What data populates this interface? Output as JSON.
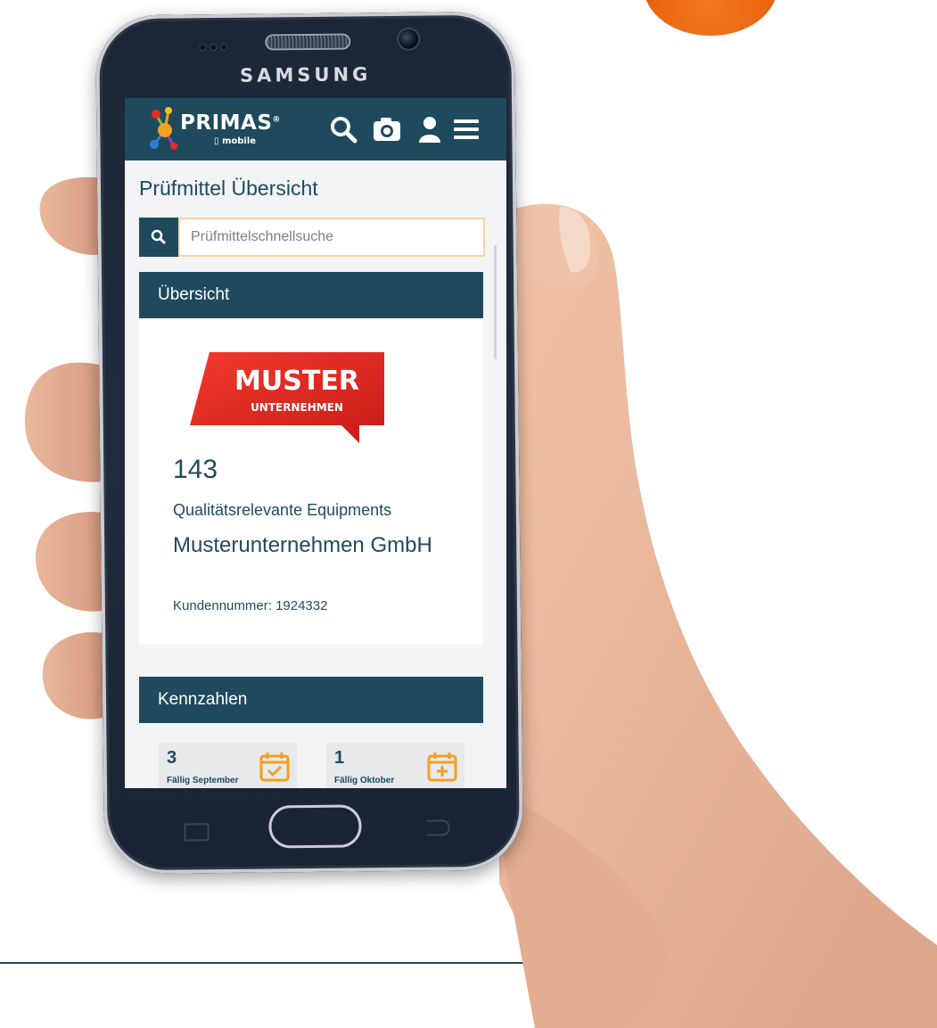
{
  "device": {
    "brand": "SAMSUNG"
  },
  "app": {
    "logo_text": "PRIMAS",
    "logo_registered": "®",
    "logo_sub": "mobile",
    "nav_icons": [
      "search-icon",
      "camera-icon",
      "user-icon",
      "menu-icon"
    ]
  },
  "page": {
    "title": "Prüfmittel Übersicht"
  },
  "search": {
    "placeholder": "Prüfmittelschnellsuche"
  },
  "overview": {
    "header": "Übersicht",
    "logo_line1": "MUSTER",
    "logo_line2": "UNTERNEHMEN",
    "count": "143",
    "count_label": "Qualitätsrelevante Equipments",
    "company": "Musterunternehmen GmbH",
    "customer_number": "Kundennummer: 1924332"
  },
  "kpis": {
    "header": "Kennzahlen",
    "items": [
      {
        "value": "3",
        "label": "Fällig September",
        "icon": "calendar-check-icon"
      },
      {
        "value": "1",
        "label": "Fällig Oktober",
        "icon": "calendar-plus-icon"
      }
    ]
  },
  "colors": {
    "primary": "#1f4a5e",
    "accent": "#f4a020",
    "brand_red": "#e52b24",
    "orange_blob": "#ec6b14"
  }
}
